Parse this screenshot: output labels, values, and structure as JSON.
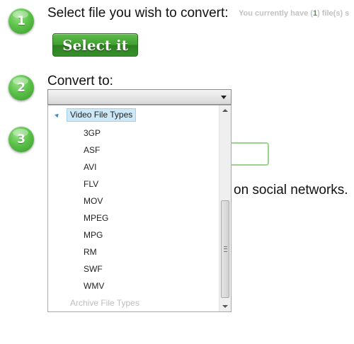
{
  "steps": [
    {
      "number": "1",
      "text": "Select file you wish to convert:"
    },
    {
      "number": "2",
      "text": "Convert to:"
    },
    {
      "number": "3"
    }
  ],
  "info": {
    "prefix": "You currently have (",
    "count": "1",
    "suffix": ") file(s) s"
  },
  "select_button": {
    "label": "Select it"
  },
  "convert": {
    "selected_value": "",
    "dropdown": {
      "group_label": "Video File Types",
      "options": [
        "3GP",
        "ASF",
        "AVI",
        "FLV",
        "MOV",
        "MPEG",
        "MPG",
        "RM",
        "SWF",
        "WMV"
      ],
      "disabled_group": "Archive File Types"
    }
  },
  "social_text": "on social networks.",
  "colors": {
    "step_green": "#4cb83a",
    "button_green": "#3f9f30",
    "highlight_blue": "#cde8f6",
    "info_gray": "#c2c2c2"
  }
}
